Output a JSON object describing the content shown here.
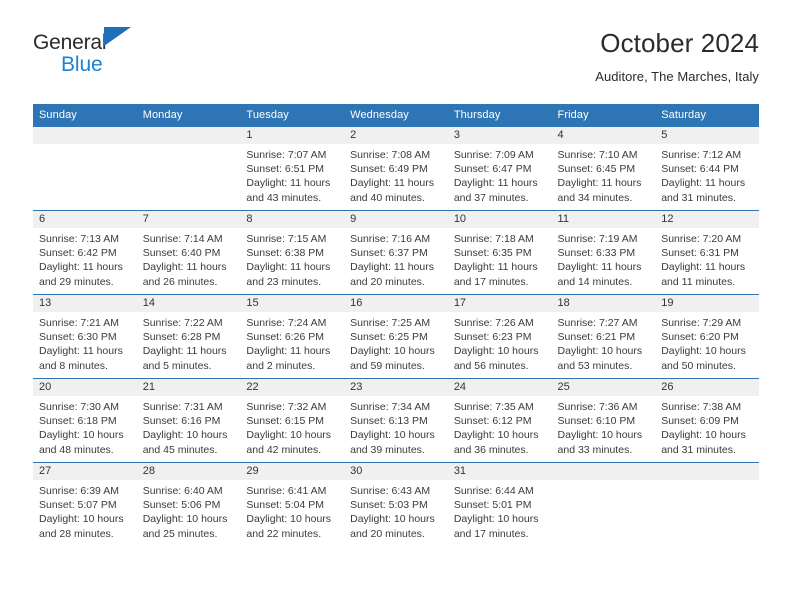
{
  "brand": {
    "name_dark": "General",
    "name_blue": "Blue",
    "triangle_icon": "triangle-icon",
    "accent_dark_blue": "#1d6fb8",
    "accent_light_blue": "#1d82d4"
  },
  "header": {
    "title": "October 2024",
    "subtitle": "Auditore, The Marches, Italy"
  },
  "theme": {
    "header_bar": "#2e75b6",
    "daynum_band": "#f0f0f0",
    "text": "#3b3b3b"
  },
  "weekdays": [
    "Sunday",
    "Monday",
    "Tuesday",
    "Wednesday",
    "Thursday",
    "Friday",
    "Saturday"
  ],
  "weeks": [
    [
      {
        "day": "",
        "sunrise": "",
        "sunset": "",
        "daylight1": "",
        "daylight2": ""
      },
      {
        "day": "",
        "sunrise": "",
        "sunset": "",
        "daylight1": "",
        "daylight2": ""
      },
      {
        "day": "1",
        "sunrise": "Sunrise: 7:07 AM",
        "sunset": "Sunset: 6:51 PM",
        "daylight1": "Daylight: 11 hours",
        "daylight2": "and 43 minutes."
      },
      {
        "day": "2",
        "sunrise": "Sunrise: 7:08 AM",
        "sunset": "Sunset: 6:49 PM",
        "daylight1": "Daylight: 11 hours",
        "daylight2": "and 40 minutes."
      },
      {
        "day": "3",
        "sunrise": "Sunrise: 7:09 AM",
        "sunset": "Sunset: 6:47 PM",
        "daylight1": "Daylight: 11 hours",
        "daylight2": "and 37 minutes."
      },
      {
        "day": "4",
        "sunrise": "Sunrise: 7:10 AM",
        "sunset": "Sunset: 6:45 PM",
        "daylight1": "Daylight: 11 hours",
        "daylight2": "and 34 minutes."
      },
      {
        "day": "5",
        "sunrise": "Sunrise: 7:12 AM",
        "sunset": "Sunset: 6:44 PM",
        "daylight1": "Daylight: 11 hours",
        "daylight2": "and 31 minutes."
      }
    ],
    [
      {
        "day": "6",
        "sunrise": "Sunrise: 7:13 AM",
        "sunset": "Sunset: 6:42 PM",
        "daylight1": "Daylight: 11 hours",
        "daylight2": "and 29 minutes."
      },
      {
        "day": "7",
        "sunrise": "Sunrise: 7:14 AM",
        "sunset": "Sunset: 6:40 PM",
        "daylight1": "Daylight: 11 hours",
        "daylight2": "and 26 minutes."
      },
      {
        "day": "8",
        "sunrise": "Sunrise: 7:15 AM",
        "sunset": "Sunset: 6:38 PM",
        "daylight1": "Daylight: 11 hours",
        "daylight2": "and 23 minutes."
      },
      {
        "day": "9",
        "sunrise": "Sunrise: 7:16 AM",
        "sunset": "Sunset: 6:37 PM",
        "daylight1": "Daylight: 11 hours",
        "daylight2": "and 20 minutes."
      },
      {
        "day": "10",
        "sunrise": "Sunrise: 7:18 AM",
        "sunset": "Sunset: 6:35 PM",
        "daylight1": "Daylight: 11 hours",
        "daylight2": "and 17 minutes."
      },
      {
        "day": "11",
        "sunrise": "Sunrise: 7:19 AM",
        "sunset": "Sunset: 6:33 PM",
        "daylight1": "Daylight: 11 hours",
        "daylight2": "and 14 minutes."
      },
      {
        "day": "12",
        "sunrise": "Sunrise: 7:20 AM",
        "sunset": "Sunset: 6:31 PM",
        "daylight1": "Daylight: 11 hours",
        "daylight2": "and 11 minutes."
      }
    ],
    [
      {
        "day": "13",
        "sunrise": "Sunrise: 7:21 AM",
        "sunset": "Sunset: 6:30 PM",
        "daylight1": "Daylight: 11 hours",
        "daylight2": "and 8 minutes."
      },
      {
        "day": "14",
        "sunrise": "Sunrise: 7:22 AM",
        "sunset": "Sunset: 6:28 PM",
        "daylight1": "Daylight: 11 hours",
        "daylight2": "and 5 minutes."
      },
      {
        "day": "15",
        "sunrise": "Sunrise: 7:24 AM",
        "sunset": "Sunset: 6:26 PM",
        "daylight1": "Daylight: 11 hours",
        "daylight2": "and 2 minutes."
      },
      {
        "day": "16",
        "sunrise": "Sunrise: 7:25 AM",
        "sunset": "Sunset: 6:25 PM",
        "daylight1": "Daylight: 10 hours",
        "daylight2": "and 59 minutes."
      },
      {
        "day": "17",
        "sunrise": "Sunrise: 7:26 AM",
        "sunset": "Sunset: 6:23 PM",
        "daylight1": "Daylight: 10 hours",
        "daylight2": "and 56 minutes."
      },
      {
        "day": "18",
        "sunrise": "Sunrise: 7:27 AM",
        "sunset": "Sunset: 6:21 PM",
        "daylight1": "Daylight: 10 hours",
        "daylight2": "and 53 minutes."
      },
      {
        "day": "19",
        "sunrise": "Sunrise: 7:29 AM",
        "sunset": "Sunset: 6:20 PM",
        "daylight1": "Daylight: 10 hours",
        "daylight2": "and 50 minutes."
      }
    ],
    [
      {
        "day": "20",
        "sunrise": "Sunrise: 7:30 AM",
        "sunset": "Sunset: 6:18 PM",
        "daylight1": "Daylight: 10 hours",
        "daylight2": "and 48 minutes."
      },
      {
        "day": "21",
        "sunrise": "Sunrise: 7:31 AM",
        "sunset": "Sunset: 6:16 PM",
        "daylight1": "Daylight: 10 hours",
        "daylight2": "and 45 minutes."
      },
      {
        "day": "22",
        "sunrise": "Sunrise: 7:32 AM",
        "sunset": "Sunset: 6:15 PM",
        "daylight1": "Daylight: 10 hours",
        "daylight2": "and 42 minutes."
      },
      {
        "day": "23",
        "sunrise": "Sunrise: 7:34 AM",
        "sunset": "Sunset: 6:13 PM",
        "daylight1": "Daylight: 10 hours",
        "daylight2": "and 39 minutes."
      },
      {
        "day": "24",
        "sunrise": "Sunrise: 7:35 AM",
        "sunset": "Sunset: 6:12 PM",
        "daylight1": "Daylight: 10 hours",
        "daylight2": "and 36 minutes."
      },
      {
        "day": "25",
        "sunrise": "Sunrise: 7:36 AM",
        "sunset": "Sunset: 6:10 PM",
        "daylight1": "Daylight: 10 hours",
        "daylight2": "and 33 minutes."
      },
      {
        "day": "26",
        "sunrise": "Sunrise: 7:38 AM",
        "sunset": "Sunset: 6:09 PM",
        "daylight1": "Daylight: 10 hours",
        "daylight2": "and 31 minutes."
      }
    ],
    [
      {
        "day": "27",
        "sunrise": "Sunrise: 6:39 AM",
        "sunset": "Sunset: 5:07 PM",
        "daylight1": "Daylight: 10 hours",
        "daylight2": "and 28 minutes."
      },
      {
        "day": "28",
        "sunrise": "Sunrise: 6:40 AM",
        "sunset": "Sunset: 5:06 PM",
        "daylight1": "Daylight: 10 hours",
        "daylight2": "and 25 minutes."
      },
      {
        "day": "29",
        "sunrise": "Sunrise: 6:41 AM",
        "sunset": "Sunset: 5:04 PM",
        "daylight1": "Daylight: 10 hours",
        "daylight2": "and 22 minutes."
      },
      {
        "day": "30",
        "sunrise": "Sunrise: 6:43 AM",
        "sunset": "Sunset: 5:03 PM",
        "daylight1": "Daylight: 10 hours",
        "daylight2": "and 20 minutes."
      },
      {
        "day": "31",
        "sunrise": "Sunrise: 6:44 AM",
        "sunset": "Sunset: 5:01 PM",
        "daylight1": "Daylight: 10 hours",
        "daylight2": "and 17 minutes."
      },
      {
        "day": "",
        "sunrise": "",
        "sunset": "",
        "daylight1": "",
        "daylight2": ""
      },
      {
        "day": "",
        "sunrise": "",
        "sunset": "",
        "daylight1": "",
        "daylight2": ""
      }
    ]
  ]
}
